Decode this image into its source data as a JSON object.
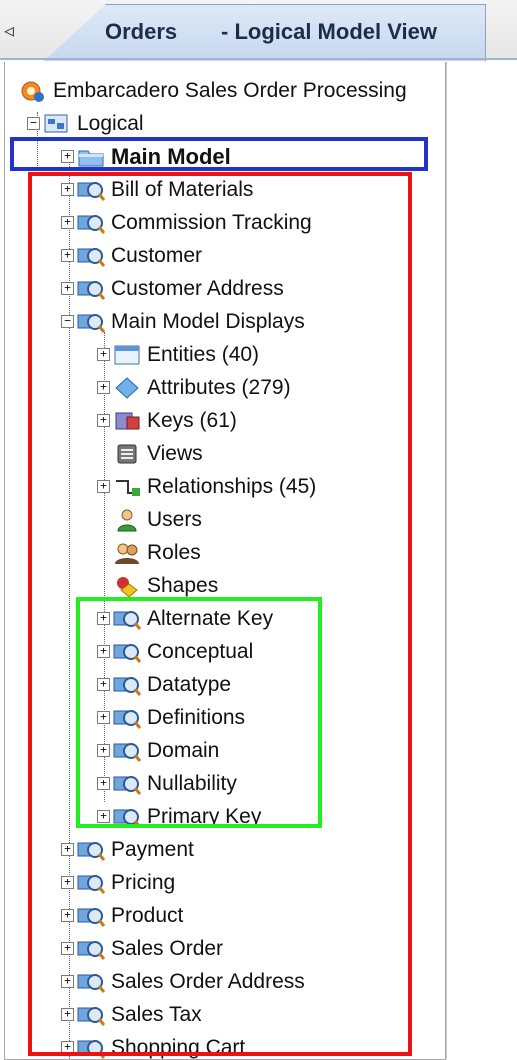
{
  "tab": {
    "title": "Orders",
    "view": "- Logical Model View",
    "scroll_left_glyph": "◃"
  },
  "tree": {
    "root": "Embarcadero Sales Order Processing",
    "logical": "Logical",
    "main_model": "Main Model",
    "submodels_top": [
      "Bill of Materials",
      "Commission Tracking",
      "Customer",
      "Customer Address",
      "Main Model Displays"
    ],
    "display_items": [
      "Entities (40)",
      "Attributes (279)",
      "Keys (61)",
      "Views",
      "Relationships (45)",
      "Users",
      "Roles",
      "Shapes"
    ],
    "display_submodels": [
      "Alternate Key",
      "Conceptual",
      "Datatype",
      "Definitions",
      "Domain",
      "Nullability",
      "Primary Key"
    ],
    "submodels_bottom": [
      "Payment",
      "Pricing",
      "Product",
      "Sales Order",
      "Sales Order Address",
      "Sales Tax",
      "Shopping Cart"
    ]
  },
  "colors": {
    "blue_box": "#2233cc",
    "red_box": "#ee1111",
    "green_box": "#22ee22"
  }
}
